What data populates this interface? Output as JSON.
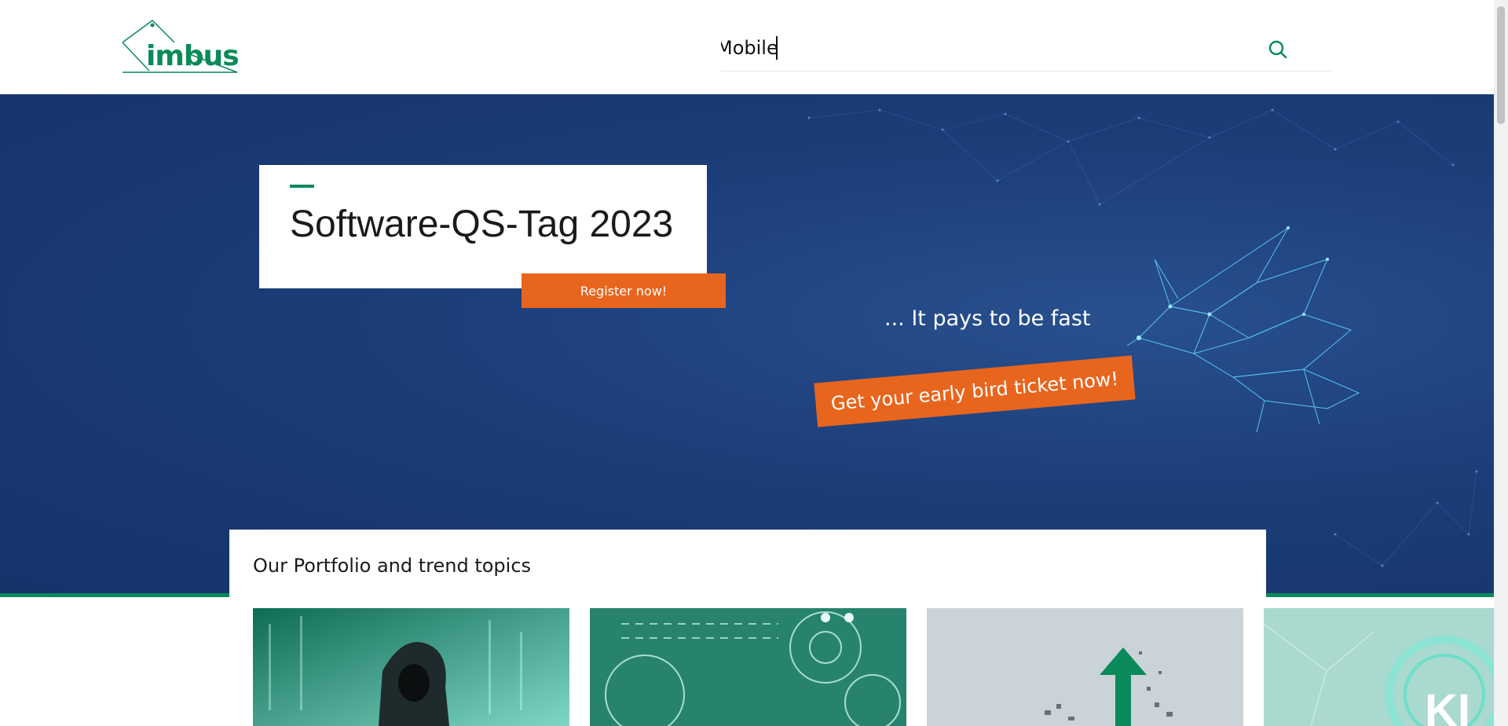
{
  "header": {
    "logo_text": "imbus",
    "search": {
      "value": "Mobile",
      "placeholder": ""
    }
  },
  "hero": {
    "title": "Software-QS-Tag 2023",
    "register_label": "Register now!",
    "tagline": "... It pays to be fast",
    "early_bird_label": "Get your early bird ticket now!"
  },
  "portfolio": {
    "title": "Our Portfolio and trend topics",
    "tiles": [
      {
        "icon": "hacker-image"
      },
      {
        "icon": "gears-image"
      },
      {
        "icon": "growth-arrow-image"
      },
      {
        "icon": "ki-image",
        "label": "KI"
      }
    ]
  },
  "colors": {
    "brand_green": "#0a8a5a",
    "accent_orange": "#e8651e",
    "hero_blue": "#1c3d78"
  }
}
